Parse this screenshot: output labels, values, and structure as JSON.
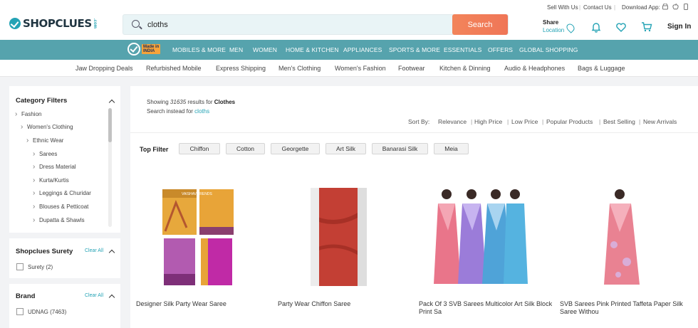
{
  "header": {
    "logo": "SHOPCLUES",
    "logo_suffix": ".com",
    "search_value": "cloths",
    "search_button": "Search",
    "sell_with_us": "Sell With Us",
    "contact_us": "Contact Us",
    "download_app": "Download App:",
    "share_title": "Share",
    "share_location": "Location",
    "sign_in": "Sign In"
  },
  "nav": {
    "badge_line1": "Made in",
    "badge_line2": "INDIA",
    "items": [
      "MOBILES & MORE",
      "MEN",
      "WOMEN",
      "HOME & KITCHEN",
      "APPLIANCES",
      "SPORTS & MORE",
      "ESSENTIALS",
      "OFFERS",
      "GLOBAL SHOPPING"
    ]
  },
  "subnav": {
    "items": [
      "Jaw Dropping Deals",
      "Refurbished Mobile",
      "Express Shipping",
      "Men's Clothing",
      "Women's Fashion",
      "Footwear",
      "Kitchen & Dinning",
      "Audio & Headphones",
      "Bags & Luggage"
    ]
  },
  "sidebar": {
    "category_title": "Category Filters",
    "tree": [
      "Fashion",
      "Women's Clothing",
      "Ethnic Wear",
      "Sarees",
      "Dress Material",
      "Kurta/Kurtis",
      "Leggings & Churidar",
      "Blouses & Petticoat",
      "Dupatta & Shawls"
    ],
    "surety_title": "Shopclues Surety",
    "clear_all": "Clear All",
    "surety_option": "Surety (2)",
    "brand_title": "Brand",
    "brand_option": "UDNAG (7463)"
  },
  "results": {
    "showing_prefix": "Showing",
    "count": "31635",
    "showing_middle": "results for",
    "query": "Clothes",
    "instead_prefix": "Search instead for",
    "instead_query": "cloths"
  },
  "sort": {
    "label": "Sort By:",
    "options": [
      "Relevance",
      "High Price",
      "Low Price",
      "Popular Products",
      "Best Selling",
      "New Arrivals"
    ]
  },
  "top_filter": {
    "label": "Top Filter",
    "chips": [
      "Chiffon",
      "Cotton",
      "Georgette",
      "Art Silk",
      "Banarasi Silk",
      "Meia"
    ]
  },
  "products": [
    {
      "name": "Designer Silk Party Wear Saree",
      "image_caption": "VAISHAV TRENDS"
    },
    {
      "name": "Party Wear Chiffon Saree"
    },
    {
      "name": "Pack Of 3 SVB Sarees Multicolor Art Silk Block Print Sa"
    },
    {
      "name": "SVB Sarees Pink Printed Taffeta Paper Silk Saree Withou"
    }
  ],
  "colors": {
    "accent": "#24a3b5",
    "nav_bg": "#56a3ad",
    "search_button": "#f07b58"
  }
}
